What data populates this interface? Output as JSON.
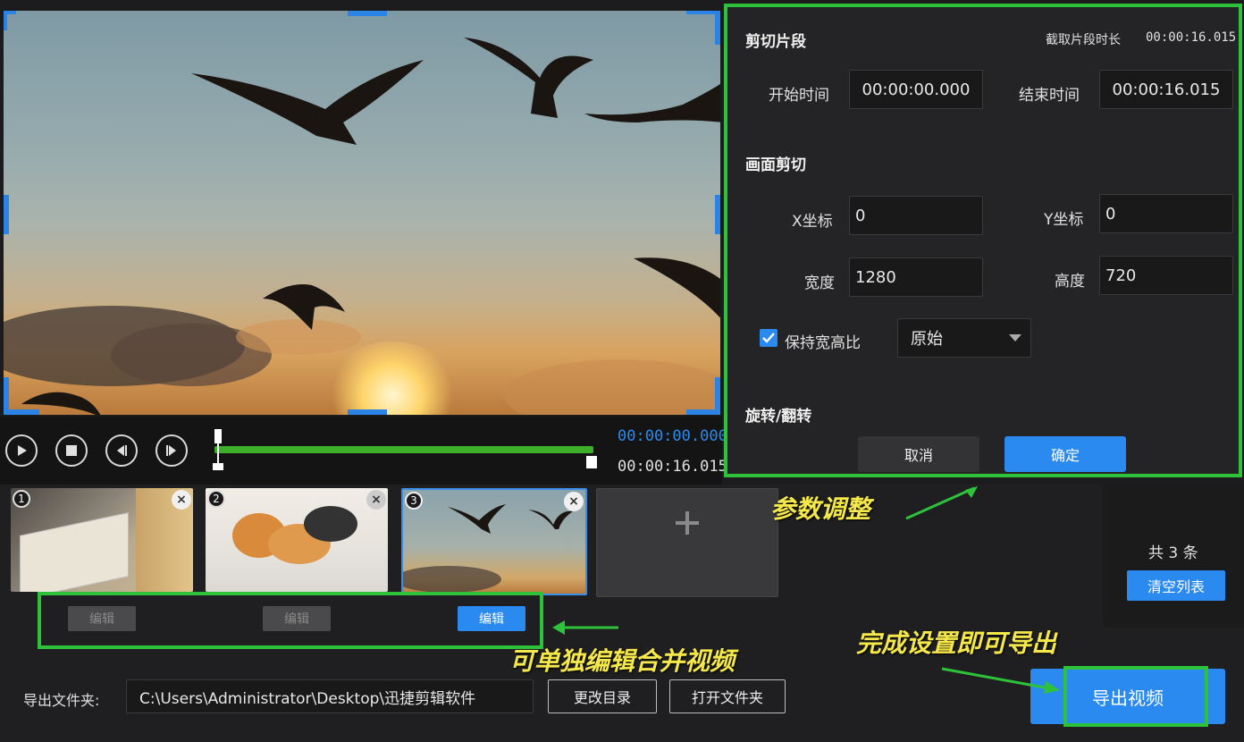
{
  "preview": {
    "scene": "seagulls flying at sunset"
  },
  "transport": {
    "current_time": "00:00:00.000",
    "end_time": "00:00:16.015",
    "controls": [
      "play-icon",
      "stop-icon",
      "prev-frame-icon",
      "next-frame-icon"
    ]
  },
  "panel": {
    "section_cut": "剪切片段",
    "duration_label": "截取片段时长",
    "duration_value": "00:00:16.015",
    "start_label": "开始时间",
    "start_value": "00:00:00.000",
    "end_label": "结束时间",
    "end_value": "00:00:16.015",
    "section_crop": "画面剪切",
    "x_label": "X坐标",
    "x_value": "0",
    "y_label": "Y坐标",
    "y_value": "0",
    "w_label": "宽度",
    "w_value": "1280",
    "h_label": "高度",
    "h_value": "720",
    "keep_ratio_label": "保持宽高比",
    "keep_ratio_checked": true,
    "ratio_option": "原始",
    "section_rotate": "旋转/翻转",
    "cancel": "取消",
    "confirm": "确定"
  },
  "clips": {
    "items": [
      {
        "num": "1",
        "edit": "编辑",
        "active": false
      },
      {
        "num": "2",
        "edit": "编辑",
        "active": false
      },
      {
        "num": "3",
        "edit": "编辑",
        "active": true
      }
    ],
    "add_icon": "plus-icon",
    "count": "共 3 条",
    "clear": "清空列表"
  },
  "export": {
    "folder_label": "导出文件夹:",
    "folder_path": "C:\\Users\\Administrator\\Desktop\\迅捷剪辑软件",
    "change_dir": "更改目录",
    "open_folder": "打开文件夹",
    "export_button": "导出视频"
  },
  "annotations": {
    "params": "参数调整",
    "edit_each": "可单独编辑合并视频",
    "done": "完成设置即可导出"
  },
  "colors": {
    "accent": "#2b8af0",
    "highlight": "#2ec23a",
    "annotation": "#f4e84a"
  }
}
